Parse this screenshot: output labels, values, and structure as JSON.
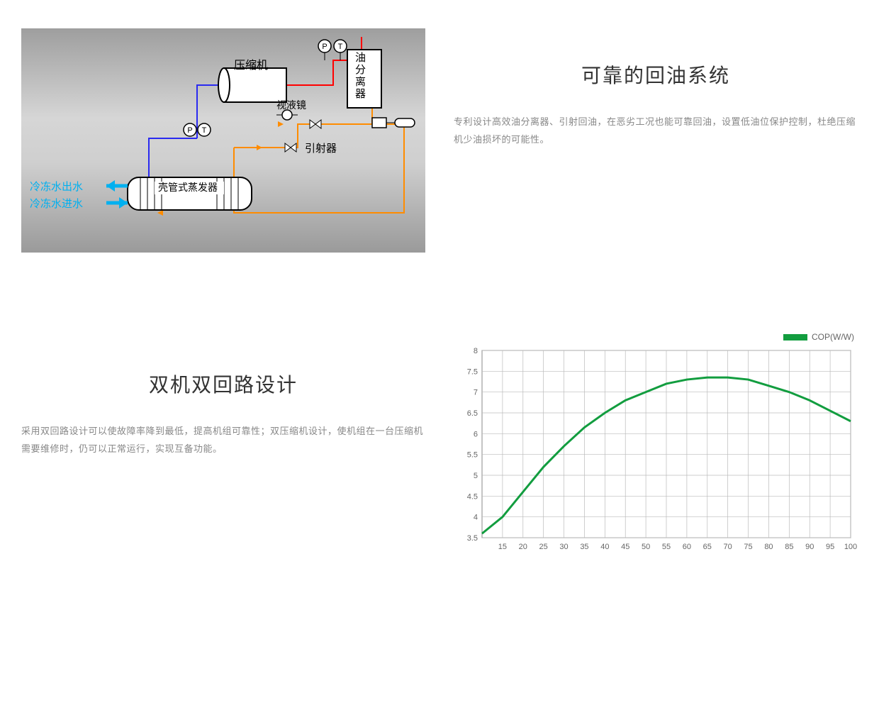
{
  "section1": {
    "title": "可靠的回油系统",
    "desc": "专利设计高效油分离器、引射回油，在恶劣工况也能可靠回油，设置低油位保护控制，杜绝压缩机少油损坏的可能性。",
    "diagram_labels": {
      "compressor": "压缩机",
      "oil_separator": "油分离器",
      "sight_glass": "视液镜",
      "ejector": "引射器",
      "shell_tube_evaporator": "壳管式蒸发器",
      "chilled_water_out": "冷冻水出水",
      "chilled_water_in": "冷冻水进水",
      "p_gauge": "P",
      "t_gauge": "T"
    }
  },
  "section2": {
    "title": "双机双回路设计",
    "desc": "采用双回路设计可以使故障率降到最低，提高机组可靠性；双压缩机设计，使机组在一台压缩机需要维修时，仍可以正常运行，实现互备功能。"
  },
  "chart_data": {
    "type": "line",
    "title": "",
    "legend": "COP(W/W)",
    "xlabel": "",
    "ylabel": "",
    "xlim": [
      10,
      100
    ],
    "ylim": [
      3.5,
      8
    ],
    "x_ticks": [
      15,
      20,
      25,
      30,
      35,
      40,
      45,
      50,
      55,
      60,
      65,
      70,
      75,
      80,
      85,
      90,
      95,
      100
    ],
    "y_ticks": [
      3.5,
      4,
      4.5,
      5,
      5.5,
      6,
      6.5,
      7,
      7.5,
      8
    ],
    "series": [
      {
        "name": "COP(W/W)",
        "color": "#129d3f",
        "x": [
          10,
          15,
          20,
          25,
          30,
          35,
          40,
          45,
          50,
          55,
          60,
          65,
          70,
          75,
          80,
          85,
          90,
          95,
          100
        ],
        "values": [
          3.6,
          4.0,
          4.6,
          5.2,
          5.7,
          6.15,
          6.5,
          6.8,
          7.0,
          7.2,
          7.3,
          7.35,
          7.35,
          7.3,
          7.15,
          7.0,
          6.8,
          6.55,
          6.3
        ]
      }
    ]
  }
}
